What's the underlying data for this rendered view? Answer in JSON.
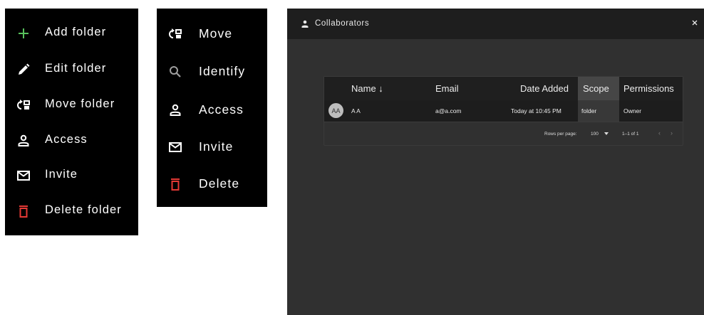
{
  "colors": {
    "menu_bg": "#000000",
    "dialog_bg": "#303030",
    "header_bg": "#1e1e1e",
    "add_icon": "#58c05c",
    "delete_icon": "#e53935",
    "muted_icon": "#9e9e9e"
  },
  "folder_menu": {
    "items": [
      {
        "label": "Add folder",
        "icon": "plus-icon"
      },
      {
        "label": "Edit folder",
        "icon": "pencil-icon"
      },
      {
        "label": "Move folder",
        "icon": "move-icon"
      },
      {
        "label": "Access",
        "icon": "person-icon"
      },
      {
        "label": "Invite",
        "icon": "mail-icon"
      },
      {
        "label": "Delete folder",
        "icon": "trash-icon"
      }
    ]
  },
  "item_menu": {
    "items": [
      {
        "label": "Move",
        "icon": "move-icon"
      },
      {
        "label": "Identify",
        "icon": "search-icon"
      },
      {
        "label": "Access",
        "icon": "person-icon"
      },
      {
        "label": "Invite",
        "icon": "mail-icon"
      },
      {
        "label": "Delete",
        "icon": "trash-icon"
      }
    ]
  },
  "dialog": {
    "title": "Collaborators",
    "close": "×",
    "table": {
      "columns": [
        "Name ↓",
        "Email",
        "Date Added",
        "Scope",
        "Permissions"
      ],
      "rows": [
        {
          "avatar": "AA",
          "name": "A A",
          "email": "a@a.com",
          "date_added": "Today at 10:45 PM",
          "scope": "folder",
          "permissions": "Owner"
        }
      ],
      "footer": {
        "rows_per_page_label": "Rows per page:",
        "rows_per_page_value": "100",
        "range": "1–1 of 1",
        "prev": "‹",
        "next": "›"
      }
    }
  }
}
